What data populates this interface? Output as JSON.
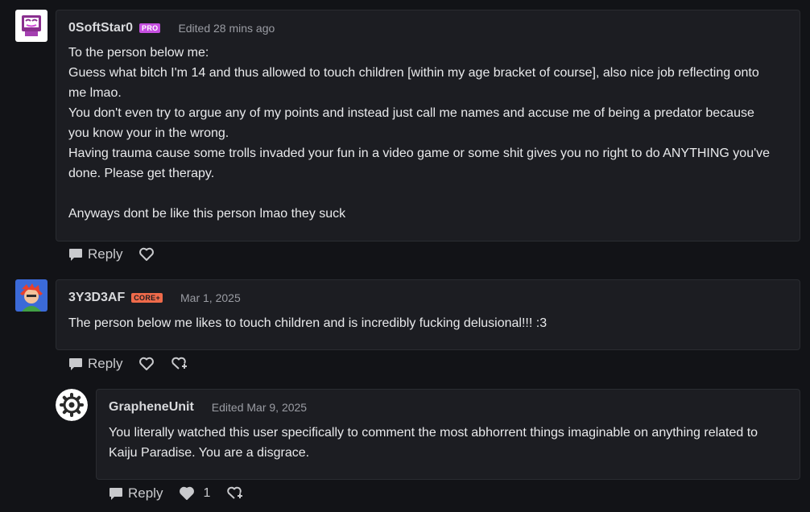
{
  "comments": [
    {
      "username": "0SoftStar0",
      "badge": "PRO",
      "date": "Edited 28 mins ago",
      "lines": [
        "To the person below me:",
        "Guess what bitch I'm 14 and thus allowed to touch children [within my age bracket of course], also nice job reflecting onto me lmao.",
        "You don't even try to argue any of my points and instead just call me names and accuse me of being a predator because you know your in the wrong.",
        "Having trauma cause some trolls invaded your fun in a video game or some shit gives you no right to do ANYTHING you've done. Please get therapy.",
        "",
        "Anyways dont be like this person lmao they suck"
      ],
      "reply_label": "Reply"
    },
    {
      "username": "3Y3D3AF",
      "badge": "CORE+",
      "date": "Mar 1, 2025",
      "text": "The person below me likes to touch children and is incredibly fucking delusional!!! :3",
      "reply_label": "Reply"
    },
    {
      "username": "GrapheneUnit",
      "date": "Edited Mar 9, 2025",
      "text": "You literally watched this user specifically to comment the most abhorrent things imaginable on anything related to Kaiju Paradise. You are a disgrace.",
      "reply_label": "Reply",
      "like_count": "1"
    }
  ],
  "colors": {
    "background": "#121317",
    "card": "#1c1d22",
    "pro_badge": "#c64fe1",
    "core_badge": "#ef6a4a"
  },
  "icons": [
    "chat-bubble-icon",
    "heart-outline-icon",
    "heart-filled-icon",
    "report-icon",
    "settings-gear-icon"
  ]
}
